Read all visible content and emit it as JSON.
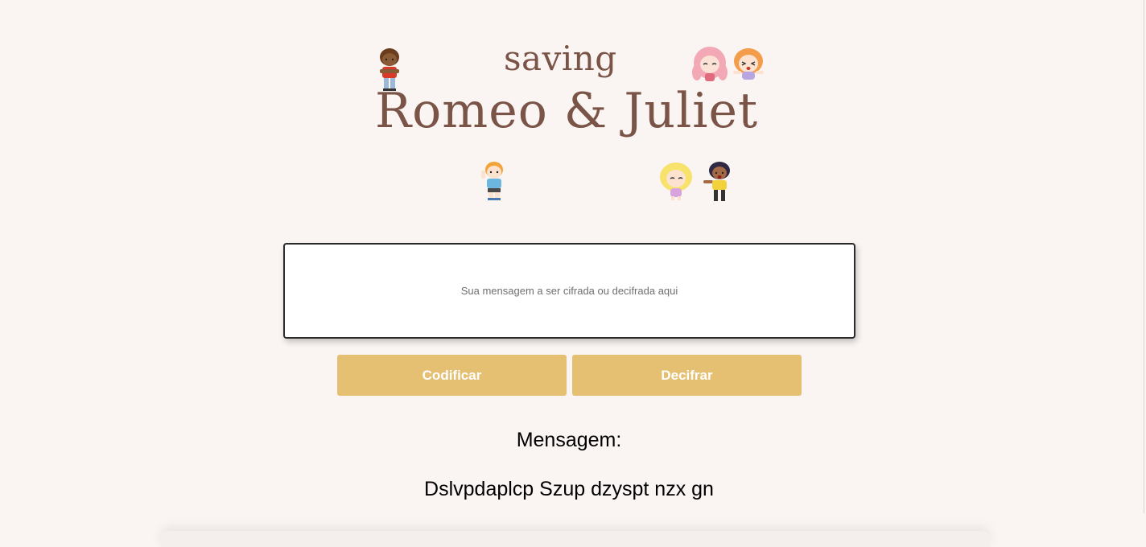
{
  "logo": {
    "saving": "saving",
    "title": "Romeo & Juliet"
  },
  "characters": [
    {
      "name": "boy-red-shirt-icon"
    },
    {
      "name": "girl-pink-hair-icon"
    },
    {
      "name": "girl-orange-hair-icon"
    },
    {
      "name": "boy-blue-shirt-icon"
    },
    {
      "name": "girl-blonde-icon"
    },
    {
      "name": "boy-yellow-shirt-icon"
    }
  ],
  "input": {
    "placeholder": "Sua mensagem a ser cifrada ou decifrada aqui",
    "value": ""
  },
  "buttons": {
    "encode": "Codificar",
    "decode": "Decifrar"
  },
  "result": {
    "label": "Mensagem:",
    "text": "Dslvpdaplcp Szup dzyspt nzx gn"
  },
  "colors": {
    "background": "#faf4f2",
    "logo": "#7a5446",
    "button": "#e5c073",
    "button_text": "#ffffff"
  }
}
